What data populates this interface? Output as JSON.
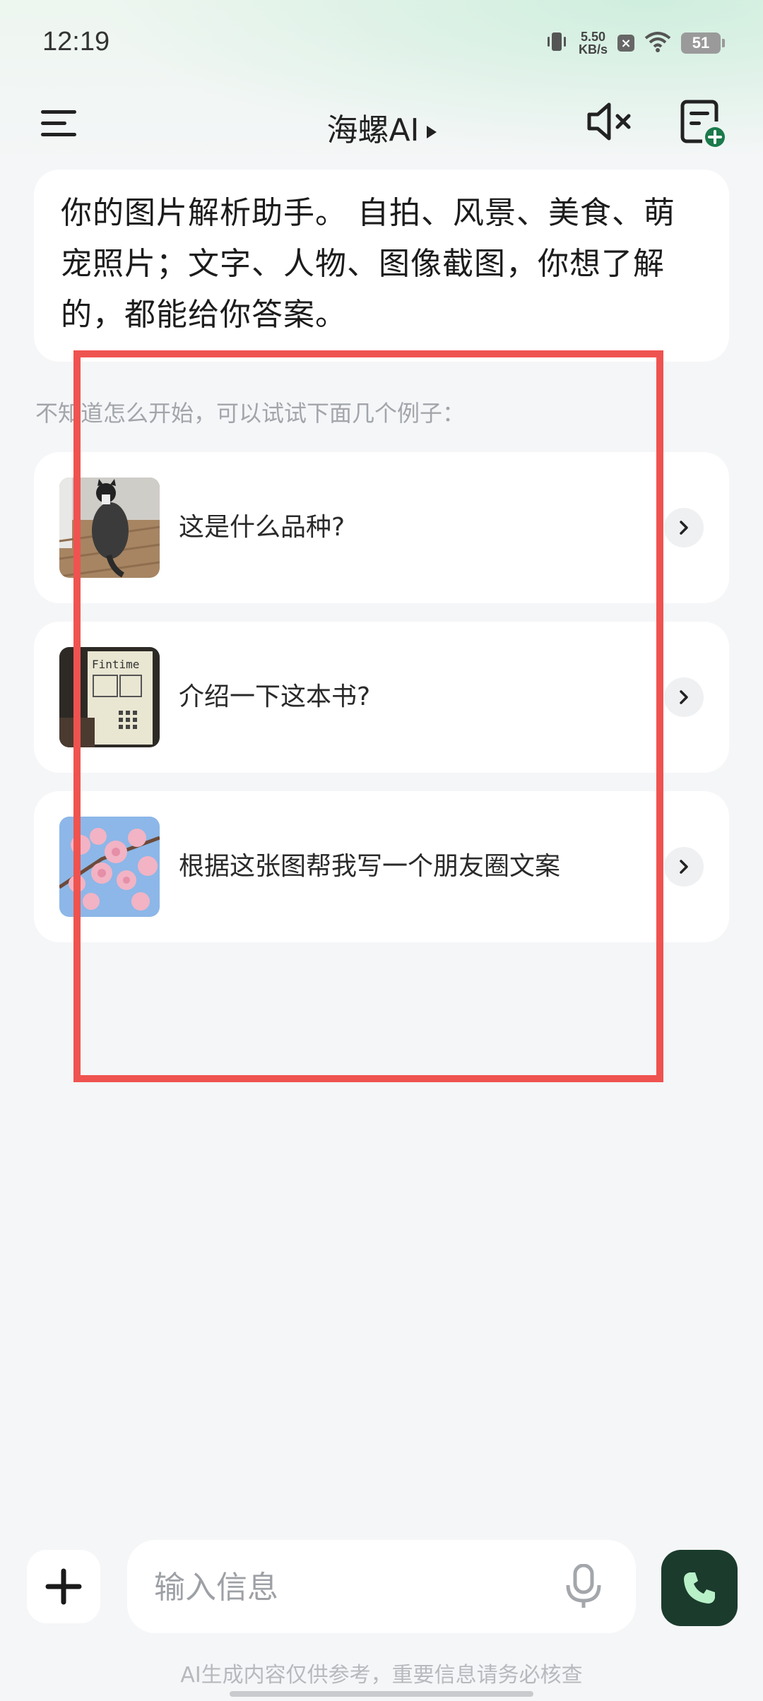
{
  "status_bar": {
    "time": "12:19",
    "net_speed_value": "5.50",
    "net_speed_unit": "KB/s",
    "battery": "51"
  },
  "header": {
    "title": "海螺AI"
  },
  "intro": {
    "text": "你的图片解析助手。 自拍、风景、美食、萌宠照片；文字、人物、图像截图，你想了解的，都能给你答案。"
  },
  "hint": "不知道怎么开始，可以试试下面几个例子：",
  "examples": [
    {
      "label": "这是什么品种?"
    },
    {
      "label": "介绍一下这本书?"
    },
    {
      "label": "根据这张图帮我写一个朋友圈文案"
    }
  ],
  "book_cover_text": "Fintime",
  "composer": {
    "placeholder": "输入信息"
  },
  "disclaimer": "AI生成内容仅供参考，重要信息请务必核查",
  "colors": {
    "accent_dark_green": "#1b3b2d",
    "highlight_red": "#ef5350",
    "call_icon_green": "#b8f0c8"
  }
}
